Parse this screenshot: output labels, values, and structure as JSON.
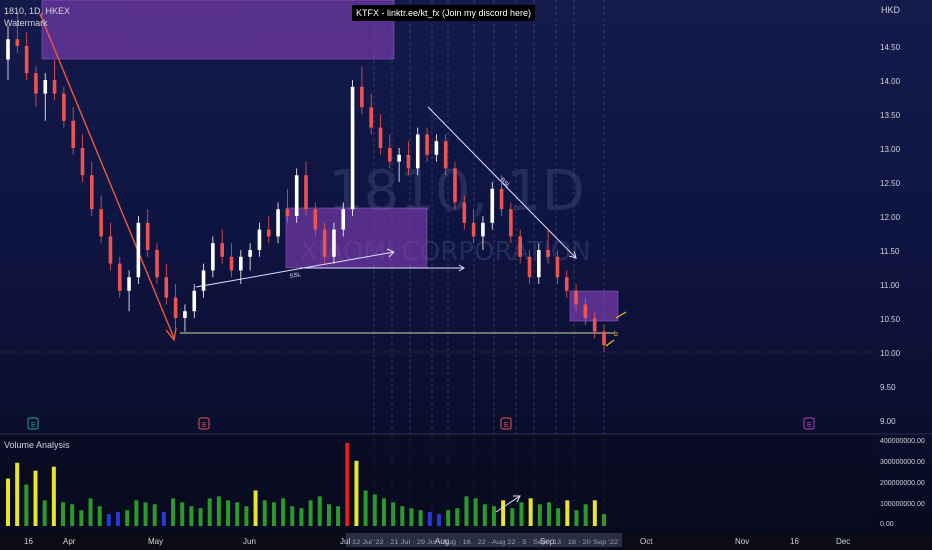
{
  "header": {
    "symbol_line": "1810, 1D, HKEX",
    "indicator_label": "Watermark",
    "banner": "KTFX - linktr.ee/kt_fx (Join my discord here)",
    "currency": "HKD"
  },
  "watermark": {
    "ticker": "1810, 1D",
    "company": "XIAOMI CORPORATION"
  },
  "price_axis": {
    "ticks": [
      "14.50",
      "14.00",
      "13.50",
      "13.00",
      "12.50",
      "12.00",
      "11.50",
      "11.00",
      "10.50",
      "10.00",
      "9.50",
      "9.00"
    ]
  },
  "volume_panel": {
    "title": "Volume Analysis",
    "ticks": [
      "400000000.00",
      "300000000.00",
      "200000000.00",
      "100000000.00",
      "0.00"
    ]
  },
  "time_axis": {
    "labels": [
      "16",
      "Apr",
      "May",
      "Jun",
      "Jul",
      "Aug",
      "Sep",
      "Oct",
      "Nov",
      "16",
      "Dec"
    ],
    "highlight_label": "12 Jul '22 · 21 Jul · 29 Jul · Aug · 16 · 22 · Aug 22 · 5 · Sep · 13 · 18 · 20 Sep '22"
  },
  "annotations": {
    "ssl_label": "SSL",
    "bsl_label": "BSL",
    "event_badges": [
      "E",
      "E",
      "E",
      "E"
    ]
  },
  "colors": {
    "bull_candle": "#ffffff",
    "bear_candle": "#ef5350",
    "zone_fill": "#8e44c4",
    "vol_green": "#2a9a2a",
    "vol_yellow": "#e6e62e",
    "vol_blue": "#2a3ad6",
    "vol_red": "#e02020",
    "trend_red": "#f05a3c"
  },
  "chart_data": {
    "type": "candlestick",
    "symbol": "1810",
    "timeframe": "1D",
    "exchange": "HKEX",
    "y_range": [
      8.9,
      15.1
    ],
    "candles": [
      [
        14.3,
        14.8,
        14.0,
        14.6
      ],
      [
        14.6,
        15.0,
        14.4,
        14.5
      ],
      [
        14.5,
        14.7,
        14.0,
        14.1
      ],
      [
        14.1,
        14.2,
        13.6,
        13.8
      ],
      [
        13.8,
        14.1,
        13.4,
        14.0
      ],
      [
        14.0,
        14.3,
        13.7,
        13.8
      ],
      [
        13.8,
        13.9,
        13.3,
        13.4
      ],
      [
        13.4,
        13.6,
        12.9,
        13.0
      ],
      [
        13.0,
        13.2,
        12.5,
        12.6
      ],
      [
        12.6,
        12.8,
        12.0,
        12.1
      ],
      [
        12.1,
        12.3,
        11.6,
        11.7
      ],
      [
        11.7,
        11.9,
        11.2,
        11.3
      ],
      [
        11.3,
        11.4,
        10.8,
        10.9
      ],
      [
        10.9,
        11.2,
        10.6,
        11.1
      ],
      [
        11.1,
        12.0,
        11.0,
        11.9
      ],
      [
        11.9,
        12.1,
        11.4,
        11.5
      ],
      [
        11.5,
        11.6,
        11.0,
        11.1
      ],
      [
        11.1,
        11.3,
        10.7,
        10.8
      ],
      [
        10.8,
        11.0,
        10.3,
        10.5
      ],
      [
        10.5,
        10.7,
        10.3,
        10.6
      ],
      [
        10.6,
        11.0,
        10.5,
        10.9
      ],
      [
        10.9,
        11.3,
        10.8,
        11.2
      ],
      [
        11.2,
        11.7,
        11.1,
        11.6
      ],
      [
        11.6,
        11.8,
        11.3,
        11.4
      ],
      [
        11.4,
        11.6,
        11.1,
        11.2
      ],
      [
        11.2,
        11.5,
        11.0,
        11.4
      ],
      [
        11.4,
        11.6,
        11.2,
        11.5
      ],
      [
        11.5,
        11.9,
        11.4,
        11.8
      ],
      [
        11.8,
        12.0,
        11.6,
        11.7
      ],
      [
        11.7,
        12.2,
        11.6,
        12.1
      ],
      [
        12.1,
        12.4,
        11.9,
        12.0
      ],
      [
        12.0,
        12.7,
        11.9,
        12.6
      ],
      [
        12.6,
        12.8,
        12.0,
        12.1
      ],
      [
        12.1,
        12.2,
        11.7,
        11.8
      ],
      [
        11.8,
        11.9,
        11.3,
        11.4
      ],
      [
        11.4,
        11.9,
        11.3,
        11.8
      ],
      [
        11.8,
        12.2,
        11.7,
        12.1
      ],
      [
        12.1,
        14.0,
        12.0,
        13.9
      ],
      [
        13.9,
        14.2,
        13.5,
        13.6
      ],
      [
        13.6,
        13.8,
        13.2,
        13.3
      ],
      [
        13.3,
        13.5,
        12.9,
        13.0
      ],
      [
        13.0,
        13.2,
        12.7,
        12.8
      ],
      [
        12.8,
        13.0,
        12.5,
        12.9
      ],
      [
        12.9,
        13.1,
        12.6,
        12.7
      ],
      [
        12.7,
        13.3,
        12.6,
        13.2
      ],
      [
        13.2,
        13.3,
        12.8,
        12.9
      ],
      [
        12.9,
        13.2,
        12.8,
        13.1
      ],
      [
        13.1,
        13.2,
        12.6,
        12.7
      ],
      [
        12.7,
        12.8,
        12.1,
        12.2
      ],
      [
        12.2,
        12.3,
        11.8,
        11.9
      ],
      [
        11.9,
        12.1,
        11.6,
        11.7
      ],
      [
        11.7,
        12.0,
        11.5,
        11.9
      ],
      [
        11.9,
        12.5,
        11.8,
        12.4
      ],
      [
        12.4,
        12.6,
        12.0,
        12.1
      ],
      [
        12.1,
        12.2,
        11.6,
        11.7
      ],
      [
        11.7,
        11.8,
        11.3,
        11.4
      ],
      [
        11.4,
        11.5,
        11.0,
        11.1
      ],
      [
        11.1,
        11.6,
        11.0,
        11.5
      ],
      [
        11.5,
        11.8,
        11.3,
        11.4
      ],
      [
        11.4,
        11.5,
        11.0,
        11.1
      ],
      [
        11.1,
        11.2,
        10.8,
        10.9
      ],
      [
        10.9,
        11.0,
        10.6,
        10.7
      ],
      [
        10.7,
        10.8,
        10.4,
        10.5
      ],
      [
        10.5,
        10.6,
        10.2,
        10.3
      ],
      [
        10.3,
        10.4,
        10.0,
        10.1
      ]
    ],
    "volume": [
      [
        240,
        "yellow"
      ],
      [
        320,
        "yellow"
      ],
      [
        210,
        "green"
      ],
      [
        280,
        "yellow"
      ],
      [
        130,
        "green"
      ],
      [
        300,
        "yellow"
      ],
      [
        120,
        "green"
      ],
      [
        110,
        "green"
      ],
      [
        80,
        "green"
      ],
      [
        140,
        "green"
      ],
      [
        100,
        "green"
      ],
      [
        60,
        "blue"
      ],
      [
        70,
        "blue"
      ],
      [
        80,
        "green"
      ],
      [
        130,
        "green"
      ],
      [
        120,
        "green"
      ],
      [
        110,
        "green"
      ],
      [
        70,
        "blue"
      ],
      [
        140,
        "green"
      ],
      [
        120,
        "green"
      ],
      [
        100,
        "green"
      ],
      [
        90,
        "green"
      ],
      [
        140,
        "green"
      ],
      [
        150,
        "green"
      ],
      [
        130,
        "green"
      ],
      [
        120,
        "green"
      ],
      [
        100,
        "green"
      ],
      [
        180,
        "yellow"
      ],
      [
        130,
        "green"
      ],
      [
        120,
        "green"
      ],
      [
        140,
        "green"
      ],
      [
        100,
        "green"
      ],
      [
        90,
        "green"
      ],
      [
        130,
        "green"
      ],
      [
        150,
        "green"
      ],
      [
        110,
        "green"
      ],
      [
        100,
        "green"
      ],
      [
        420,
        "red"
      ],
      [
        330,
        "yellow"
      ],
      [
        180,
        "green"
      ],
      [
        160,
        "green"
      ],
      [
        140,
        "green"
      ],
      [
        120,
        "green"
      ],
      [
        100,
        "green"
      ],
      [
        90,
        "green"
      ],
      [
        80,
        "green"
      ],
      [
        70,
        "blue"
      ],
      [
        60,
        "blue"
      ],
      [
        80,
        "green"
      ],
      [
        90,
        "green"
      ],
      [
        150,
        "green"
      ],
      [
        140,
        "green"
      ],
      [
        110,
        "green"
      ],
      [
        100,
        "green"
      ],
      [
        130,
        "yellow"
      ],
      [
        90,
        "green"
      ],
      [
        120,
        "green"
      ],
      [
        140,
        "yellow"
      ],
      [
        110,
        "green"
      ],
      [
        120,
        "green"
      ],
      [
        90,
        "green"
      ],
      [
        130,
        "yellow"
      ],
      [
        80,
        "green"
      ],
      [
        110,
        "green"
      ],
      [
        130,
        "yellow"
      ],
      [
        60,
        "green"
      ]
    ]
  }
}
